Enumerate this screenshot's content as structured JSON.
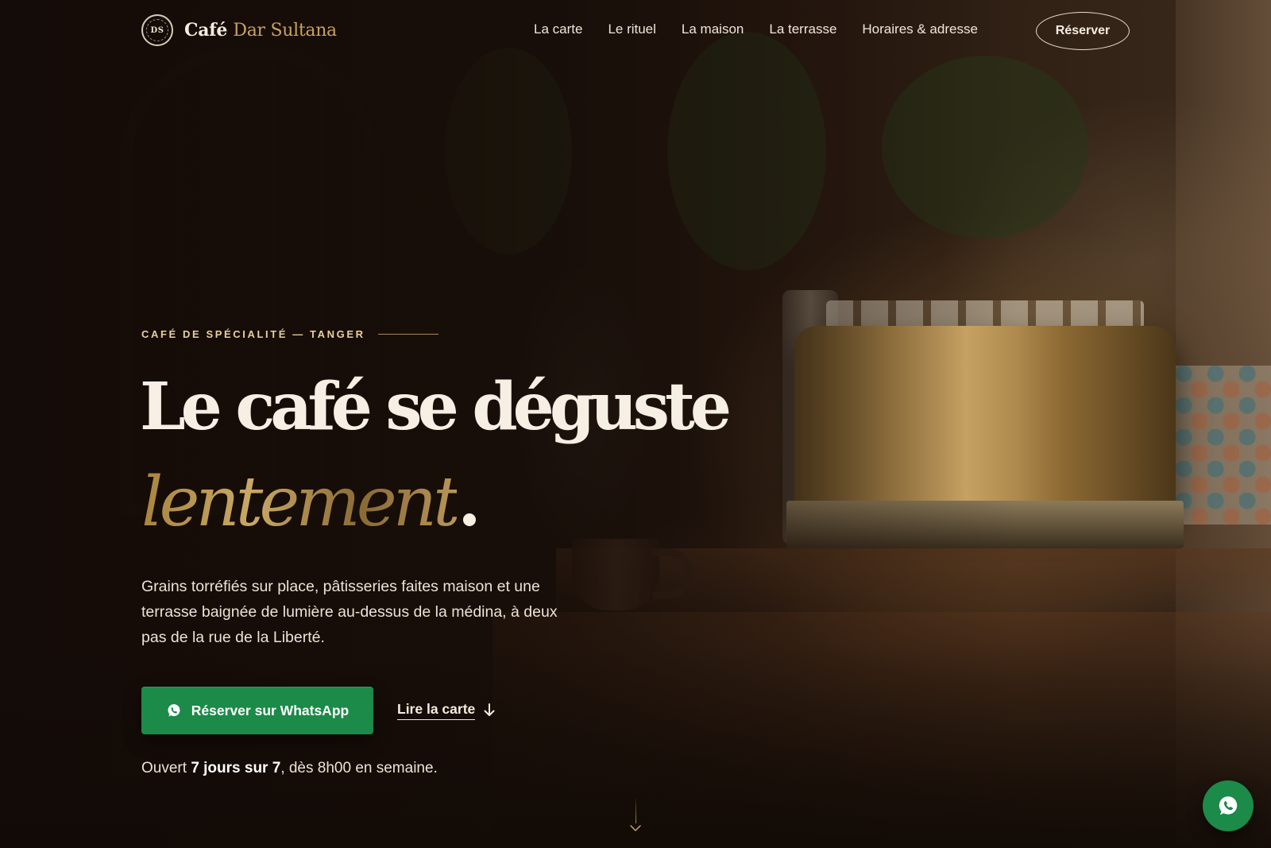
{
  "header": {
    "logo_initials": "DS",
    "brand_first": "Café",
    "brand_second": "Dar Sultana",
    "nav": [
      {
        "label": "La carte"
      },
      {
        "label": "Le rituel"
      },
      {
        "label": "La maison"
      },
      {
        "label": "La terrasse"
      },
      {
        "label": "Horaires & adresse"
      }
    ],
    "reserve_label": "Réserver"
  },
  "hero": {
    "eyebrow": "Café de spécialité — Tanger",
    "headline": "Le café se déguste",
    "headline_accent": "lentement",
    "headline_dot": ".",
    "lead": "Grains torréfiés sur place, pâtisseries faites maison et une terrasse baignée de lumière au-dessus de la médina, à deux pas de la rue de la Liberté.",
    "cta_whatsapp": "Réserver sur WhatsApp",
    "cta_menu": "Lire la carte",
    "hours_prefix": "Ouvert ",
    "hours_bold": "7 jours sur 7",
    "hours_suffix": ", dès 8h00 en semaine."
  },
  "colors": {
    "background": "#1a0f0a",
    "accent_gold": "#c9a25f",
    "eyebrow_gold": "#e8cf9b",
    "whatsapp_green": "#1c8a48",
    "text_cream": "#f6efe3"
  },
  "icons": {
    "logo": "seal-logo",
    "cta_whatsapp": "whatsapp-icon",
    "cta_menu": "arrow-down-icon",
    "scroll": "chevron-down-icon",
    "floating": "whatsapp-icon"
  }
}
